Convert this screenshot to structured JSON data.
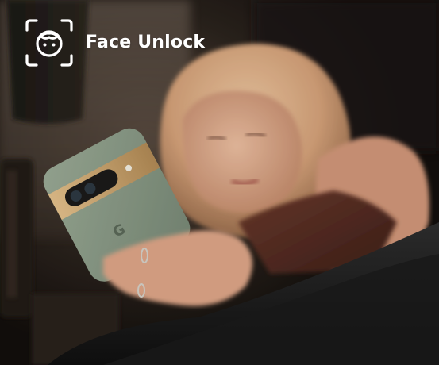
{
  "feature": {
    "label": "Face Unlock",
    "icon": "face-scan-icon"
  },
  "colors": {
    "label": "#ffffff",
    "icon": "#ffffff",
    "phone_body": "#8fa08c",
    "camera_bar": "#d6b27a",
    "hair": "#e0b48c",
    "skin": "#e8b69a",
    "top": "#5e3228",
    "bedding": "#242424"
  }
}
